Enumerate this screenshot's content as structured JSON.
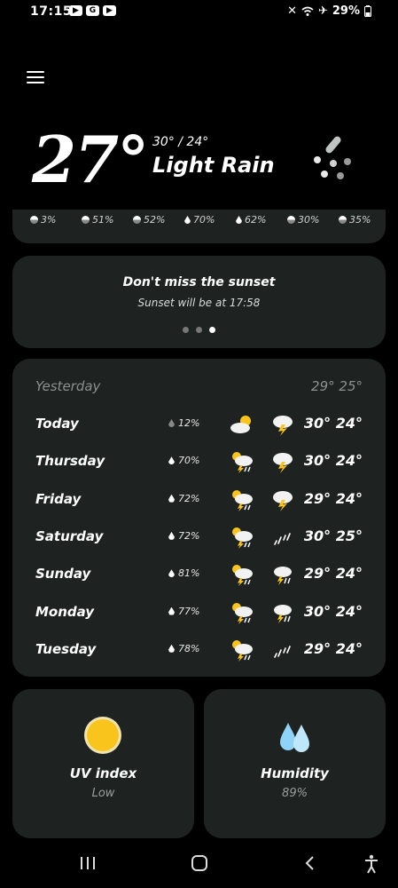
{
  "status": {
    "time": "17:15",
    "apps": [
      "▶",
      "G",
      "▶"
    ],
    "battery": "29%"
  },
  "current": {
    "temp": "27°",
    "hilo": "30° / 24°",
    "condition": "Light Rain"
  },
  "hourly": [
    {
      "pct": "3%",
      "icon": "half-drop-icon"
    },
    {
      "pct": "51%",
      "icon": "half-drop-icon"
    },
    {
      "pct": "52%",
      "icon": "half-drop-icon"
    },
    {
      "pct": "70%",
      "icon": "drop-icon"
    },
    {
      "pct": "62%",
      "icon": "drop-icon"
    },
    {
      "pct": "30%",
      "icon": "half-drop-icon"
    },
    {
      "pct": "35%",
      "icon": "half-drop-icon"
    }
  ],
  "sunset": {
    "title": "Don't miss the sunset",
    "subtitle": "Sunset will be at 17:58"
  },
  "yesterday": {
    "label": "Yesterday",
    "temps": "29° 25°"
  },
  "days": [
    {
      "name": "Today",
      "pct": "12%",
      "icon1": "partly-sunny-icon",
      "icon2": "thunderstorm-icon",
      "temps": "30° 24°"
    },
    {
      "name": "Thursday",
      "pct": "70%",
      "icon1": "sun-thunder-rain-icon",
      "icon2": "thunderstorm-icon",
      "temps": "30° 24°"
    },
    {
      "name": "Friday",
      "pct": "72%",
      "icon1": "sun-thunder-rain-icon",
      "icon2": "thunderstorm-icon",
      "temps": "29° 24°"
    },
    {
      "name": "Saturday",
      "pct": "72%",
      "icon1": "sun-thunder-rain-icon",
      "icon2": "rain-icon",
      "temps": "30° 25°"
    },
    {
      "name": "Sunday",
      "pct": "81%",
      "icon1": "sun-thunder-rain-icon",
      "icon2": "thunder-rain-icon",
      "temps": "29° 24°"
    },
    {
      "name": "Monday",
      "pct": "77%",
      "icon1": "sun-thunder-rain-icon",
      "icon2": "thunder-rain-icon",
      "temps": "30° 24°"
    },
    {
      "name": "Tuesday",
      "pct": "78%",
      "icon1": "sun-thunder-rain-icon",
      "icon2": "rain-icon",
      "temps": "29° 24°"
    }
  ],
  "uv": {
    "label": "UV index",
    "value": "Low"
  },
  "humidity": {
    "label": "Humidity",
    "value": "89%"
  },
  "colors": {
    "background": "#000000",
    "card": "#1e2322",
    "sun": "#f9c41c",
    "humidity": "#8fd3f7"
  }
}
